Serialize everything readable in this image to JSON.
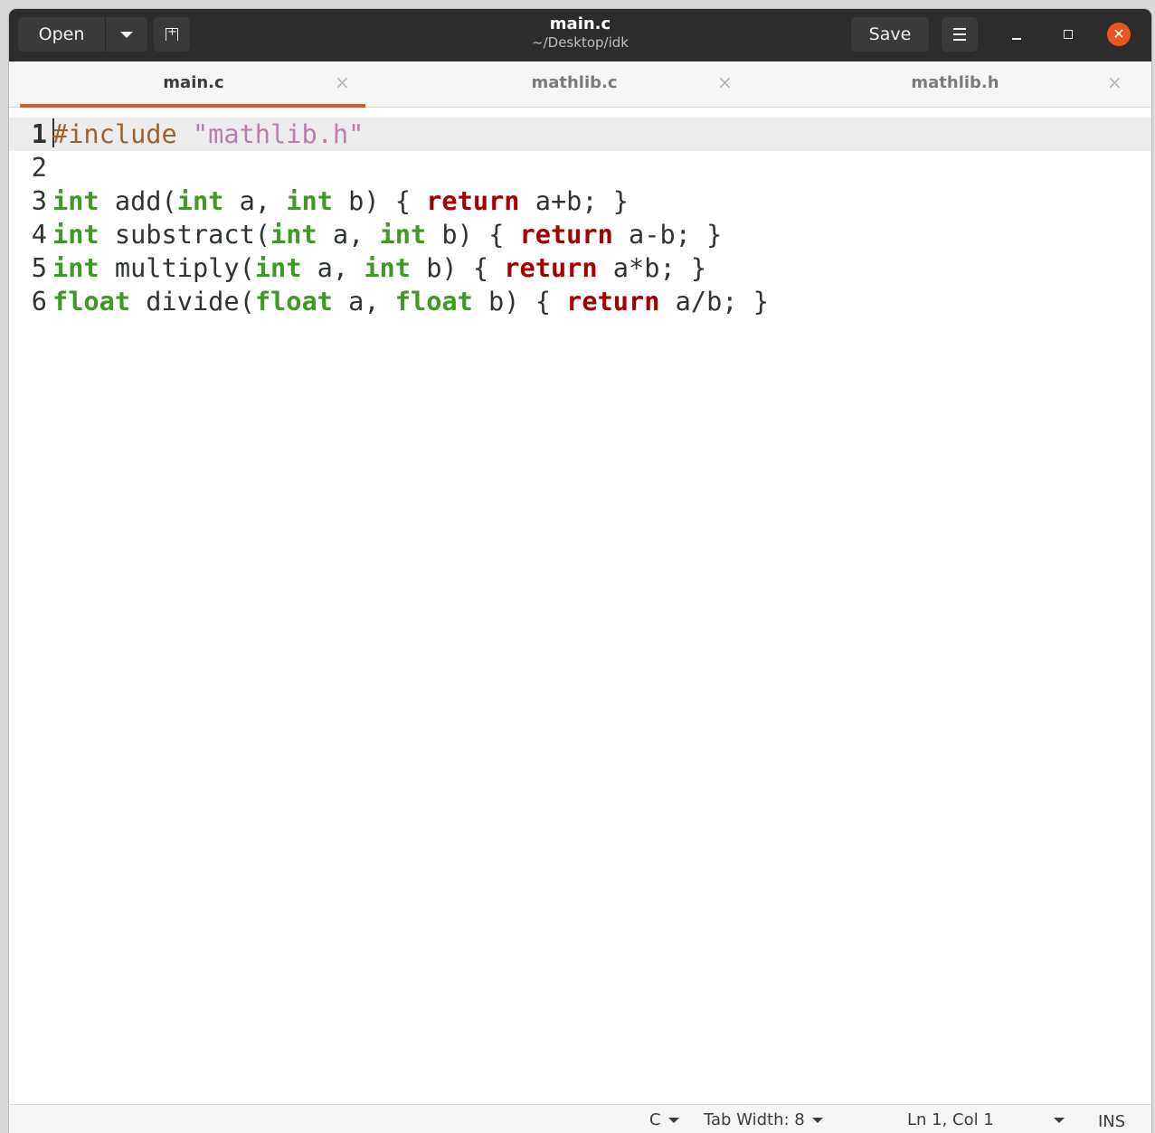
{
  "header": {
    "open_label": "Open",
    "title": "main.c",
    "subtitle": "~/Desktop/idk",
    "save_label": "Save"
  },
  "tabs": [
    {
      "label": "main.c",
      "active": true
    },
    {
      "label": "mathlib.c",
      "active": false
    },
    {
      "label": "mathlib.h",
      "active": false
    }
  ],
  "tab_close_glyph": "×",
  "close_glyph": "✕",
  "editor": {
    "lines": [
      {
        "number": "1",
        "tokens": [
          {
            "t": "pp",
            "v": "#include "
          },
          {
            "t": "str",
            "v": "\"mathlib.h\""
          }
        ]
      },
      {
        "number": "2",
        "tokens": []
      },
      {
        "number": "3",
        "tokens": [
          {
            "t": "type",
            "v": "int"
          },
          {
            "t": "plain",
            "v": " add("
          },
          {
            "t": "type",
            "v": "int"
          },
          {
            "t": "plain",
            "v": " a, "
          },
          {
            "t": "type",
            "v": "int"
          },
          {
            "t": "plain",
            "v": " b) { "
          },
          {
            "t": "kw",
            "v": "return"
          },
          {
            "t": "plain",
            "v": " a+b; }"
          }
        ]
      },
      {
        "number": "4",
        "tokens": [
          {
            "t": "type",
            "v": "int"
          },
          {
            "t": "plain",
            "v": " substract("
          },
          {
            "t": "type",
            "v": "int"
          },
          {
            "t": "plain",
            "v": " a, "
          },
          {
            "t": "type",
            "v": "int"
          },
          {
            "t": "plain",
            "v": " b) { "
          },
          {
            "t": "kw",
            "v": "return"
          },
          {
            "t": "plain",
            "v": " a-b; }"
          }
        ]
      },
      {
        "number": "5",
        "tokens": [
          {
            "t": "type",
            "v": "int"
          },
          {
            "t": "plain",
            "v": " multiply("
          },
          {
            "t": "type",
            "v": "int"
          },
          {
            "t": "plain",
            "v": " a, "
          },
          {
            "t": "type",
            "v": "int"
          },
          {
            "t": "plain",
            "v": " b) { "
          },
          {
            "t": "kw",
            "v": "return"
          },
          {
            "t": "plain",
            "v": " a*b; }"
          }
        ]
      },
      {
        "number": "6",
        "tokens": [
          {
            "t": "type",
            "v": "float"
          },
          {
            "t": "plain",
            "v": " divide("
          },
          {
            "t": "type",
            "v": "float"
          },
          {
            "t": "plain",
            "v": " a, "
          },
          {
            "t": "type",
            "v": "float"
          },
          {
            "t": "plain",
            "v": " b) { "
          },
          {
            "t": "kw",
            "v": "return"
          },
          {
            "t": "plain",
            "v": " a/b; }"
          }
        ]
      }
    ]
  },
  "status": {
    "language": "C",
    "tab_width": "Tab Width: 8",
    "cursor_position": "Ln 1, Col 1",
    "mode": "INS"
  },
  "colors": {
    "accent": "#e95420",
    "preprocessor": "#a0622a",
    "string": "#bc7cb0",
    "type": "#3d9a23",
    "keyword": "#a50000"
  },
  "icons": {
    "open_dropdown": "chevron-down-icon",
    "new_tab": "new-tab-icon",
    "menu": "hamburger-menu-icon",
    "minimize": "minimize-icon",
    "maximize": "maximize-icon",
    "close": "close-icon"
  }
}
